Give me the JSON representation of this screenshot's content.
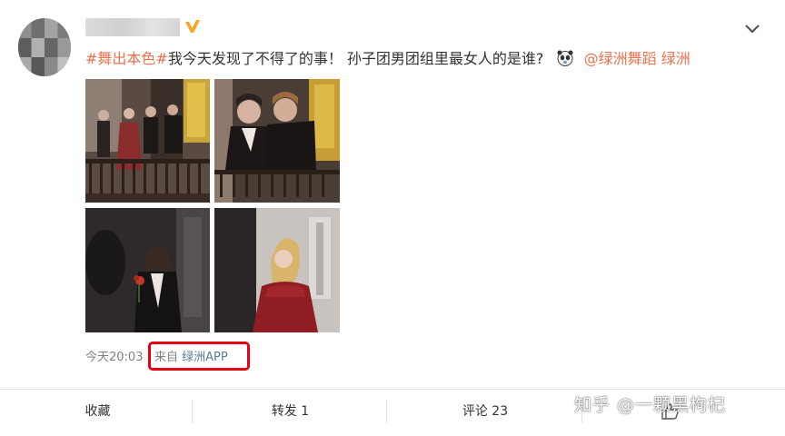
{
  "post": {
    "topic": "#舞出本色#",
    "text": "我今天发现了不得了的事！ 孙子团男团组里最女人的是谁?",
    "mention": "@绿洲舞蹈",
    "link_label": "绿洲",
    "emoji_icon": "panda-face-emoji-icon"
  },
  "meta": {
    "time": "今天20:03",
    "source_prefix": "来自",
    "source_app": "绿洲APP"
  },
  "actions": {
    "favorite": "收藏",
    "repost": "转发 1",
    "comment": "评论 23",
    "like_icon": "thumbs-up-icon"
  },
  "watermark": "知乎 @一颗黑枸杞",
  "colors": {
    "accent": "#eb7350",
    "highlight_box": "#e60012",
    "meta_text": "#808080"
  }
}
